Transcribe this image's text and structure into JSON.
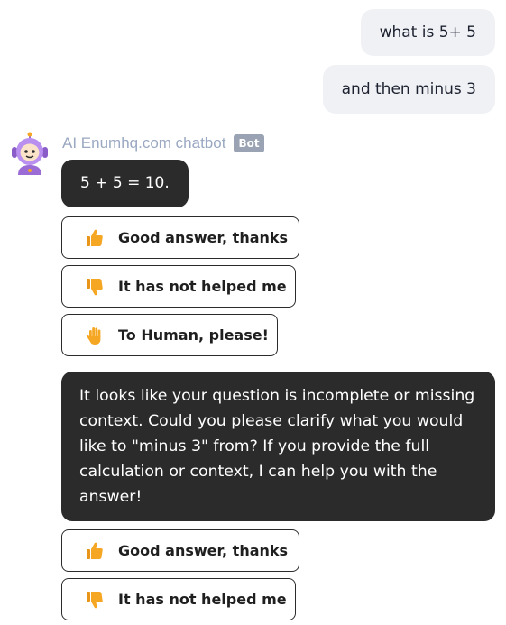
{
  "messages": {
    "user": [
      "what is 5+ 5",
      "and then minus 3"
    ],
    "bot": {
      "name": "AI Enumhq.com chatbot",
      "badge": "Bot",
      "reply1": "5 + 5 = 10.",
      "reply2": "It looks like your question is incomplete or missing context. Could you please clarify what you would like to \"minus 3\" from? If you provide the full calculation or context, I can help you with the answer!"
    }
  },
  "feedback": {
    "good": "Good answer, thanks",
    "bad": "It has not helped me",
    "human": "To Human, please!"
  },
  "icons": {
    "good": "thumbs-up-icon",
    "bad": "thumbs-down-icon",
    "human": "raised-hand-icon",
    "avatar": "robot-avatar-icon"
  },
  "colors": {
    "bot_bubble": "#2b2b2b",
    "user_bubble": "#f0f1f5",
    "bot_name": "#9aa8c2",
    "emoji": "#f5a623"
  }
}
